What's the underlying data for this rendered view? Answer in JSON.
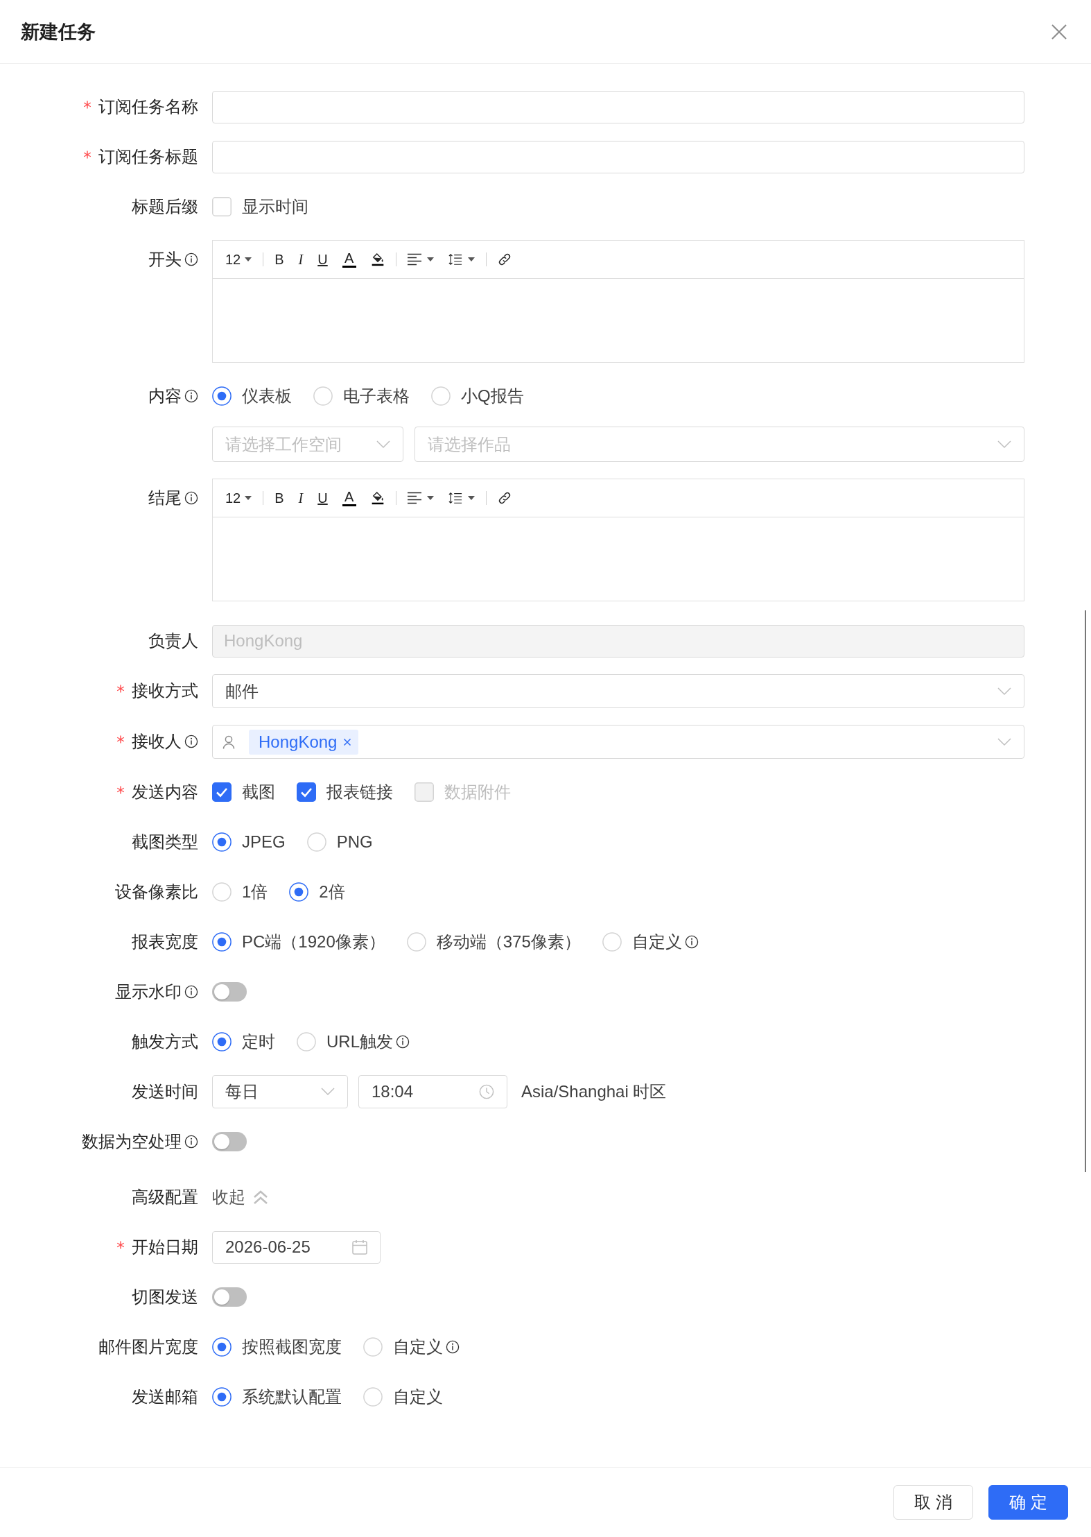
{
  "dialog": {
    "title": "新建任务"
  },
  "fields": [
    {
      "kind": "input",
      "label": "订阅任务名称",
      "required": true,
      "info": false,
      "disabled": false
    },
    {
      "kind": "input",
      "label": "订阅任务标题",
      "required": true,
      "info": false,
      "disabled": false
    },
    {
      "kind": "checkboxes",
      "label": "标题后缀",
      "required": false,
      "info": false,
      "options": [
        {
          "label": "显示时间",
          "checked": false,
          "disabled": false
        }
      ]
    },
    {
      "kind": "editor",
      "label": "开头",
      "required": false,
      "info": true,
      "toolbar": [
        {
          "items": [
            {
              "kind": "font_size",
              "label": "12"
            }
          ]
        },
        {
          "items": [
            {
              "kind": "bold",
              "label": "B"
            },
            {
              "kind": "italic",
              "label": "I"
            },
            {
              "kind": "underline",
              "label": "U"
            },
            {
              "kind": "text_color",
              "label": "A"
            },
            {
              "kind": "highlight"
            }
          ]
        },
        {
          "items": [
            {
              "kind": "align"
            },
            {
              "kind": "line_height"
            }
          ]
        },
        {
          "items": [
            {
              "kind": "link"
            }
          ]
        }
      ]
    },
    {
      "kind": "radios",
      "label": "内容",
      "required": false,
      "info": true,
      "options": [
        {
          "label": "仪表板",
          "selected": true,
          "info": false
        },
        {
          "label": "电子表格",
          "selected": false,
          "info": false
        },
        {
          "label": "小Q报告",
          "selected": false,
          "info": false
        }
      ]
    },
    {
      "kind": "selects",
      "selects": [
        {
          "placeholder": "请选择工作空间"
        },
        {
          "placeholder": "请选择作品"
        }
      ]
    },
    {
      "kind": "editor",
      "label": "结尾",
      "required": false,
      "info": true,
      "toolbar": [
        {
          "items": [
            {
              "kind": "font_size",
              "label": "12"
            }
          ]
        },
        {
          "items": [
            {
              "kind": "bold",
              "label": "B"
            },
            {
              "kind": "italic",
              "label": "I"
            },
            {
              "kind": "underline",
              "label": "U"
            },
            {
              "kind": "text_color",
              "label": "A"
            },
            {
              "kind": "highlight"
            }
          ]
        },
        {
          "items": [
            {
              "kind": "align"
            },
            {
              "kind": "line_height"
            }
          ]
        },
        {
          "items": [
            {
              "kind": "link"
            }
          ]
        }
      ]
    },
    {
      "kind": "input",
      "label": "负责人",
      "required": false,
      "info": false,
      "value": "HongKong",
      "disabled": true
    },
    {
      "kind": "select",
      "label": "接收方式",
      "required": true,
      "info": false,
      "value": "邮件"
    },
    {
      "kind": "tags",
      "label": "接收人",
      "required": true,
      "info": true,
      "tags": [
        {
          "label": "HongKong"
        }
      ]
    },
    {
      "kind": "checkboxes",
      "label": "发送内容",
      "required": true,
      "info": false,
      "options": [
        {
          "label": "截图",
          "checked": true,
          "disabled": false
        },
        {
          "label": "报表链接",
          "checked": true,
          "disabled": false
        },
        {
          "label": "数据附件",
          "checked": false,
          "disabled": true
        }
      ]
    },
    {
      "kind": "radios",
      "label": "截图类型",
      "required": false,
      "info": false,
      "options": [
        {
          "label": "JPEG",
          "selected": true,
          "info": false
        },
        {
          "label": "PNG",
          "selected": false,
          "info": false
        }
      ]
    },
    {
      "kind": "radios",
      "label": "设备像素比",
      "required": false,
      "info": false,
      "options": [
        {
          "label": "1倍",
          "selected": false,
          "info": false
        },
        {
          "label": "2倍",
          "selected": true,
          "info": false
        }
      ]
    },
    {
      "kind": "radios",
      "label": "报表宽度",
      "required": false,
      "info": false,
      "options": [
        {
          "label": "PC端（1920像素）",
          "selected": true,
          "info": false
        },
        {
          "label": "移动端（375像素）",
          "selected": false,
          "info": false
        },
        {
          "label": "自定义",
          "selected": false,
          "info": true
        }
      ]
    },
    {
      "kind": "switch",
      "label": "显示水印",
      "required": false,
      "info": true,
      "on": false
    },
    {
      "kind": "radios",
      "label": "触发方式",
      "required": false,
      "info": false,
      "options": [
        {
          "label": "定时",
          "selected": true,
          "info": false
        },
        {
          "label": "URL触发",
          "selected": false,
          "info": true
        }
      ]
    },
    {
      "kind": "schedule",
      "label": "发送时间",
      "required": false,
      "info": false,
      "frequency": "每日",
      "time": "18:04",
      "timezone": "Asia/Shanghai 时区"
    },
    {
      "kind": "switch",
      "label": "数据为空处理",
      "required": false,
      "info": true,
      "on": false
    },
    {
      "kind": "collapse",
      "label": "高级配置",
      "required": false,
      "info": false,
      "action": "收起",
      "expanded": true
    },
    {
      "kind": "date",
      "label": "开始日期",
      "required": true,
      "info": false,
      "value": "2026-06-25"
    },
    {
      "kind": "switch",
      "label": "切图发送",
      "required": false,
      "info": false,
      "on": false
    },
    {
      "kind": "radios",
      "label": "邮件图片宽度",
      "required": false,
      "info": false,
      "options": [
        {
          "label": "按照截图宽度",
          "selected": true,
          "info": false
        },
        {
          "label": "自定义",
          "selected": false,
          "info": true
        }
      ]
    },
    {
      "kind": "radios",
      "label": "发送邮箱",
      "required": false,
      "info": false,
      "options": [
        {
          "label": "系统默认配置",
          "selected": true,
          "info": false
        },
        {
          "label": "自定义",
          "selected": false,
          "info": false
        }
      ]
    }
  ],
  "footer": {
    "buttons": [
      {
        "label": "取 消",
        "kind": "default"
      },
      {
        "label": "确 定",
        "kind": "primary"
      }
    ]
  }
}
